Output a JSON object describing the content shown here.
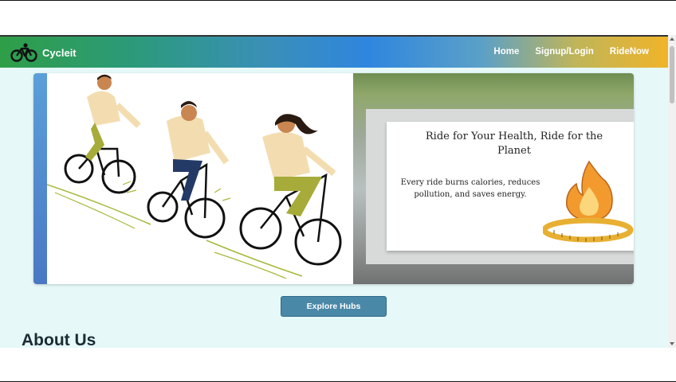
{
  "navbar": {
    "brand_name": "Cycleit",
    "brand_icon": "bicycle-icon",
    "links": [
      {
        "label": "Home"
      },
      {
        "label": "Signup/Login"
      },
      {
        "label": "RideNow"
      }
    ]
  },
  "carousel": {
    "slide": {
      "title": "Ride for Your Health, Ride for the Planet",
      "text": "Every ride burns calories, reduces pollution, and saves energy.",
      "icons": [
        "flame-icon",
        "measuring-tape-icon"
      ]
    }
  },
  "explore_button": "Explore Hubs",
  "about": {
    "heading": "About Us"
  },
  "colors": {
    "background": "#e6f8f8",
    "button": "#4a88a8",
    "heading": "#1d2b33"
  }
}
